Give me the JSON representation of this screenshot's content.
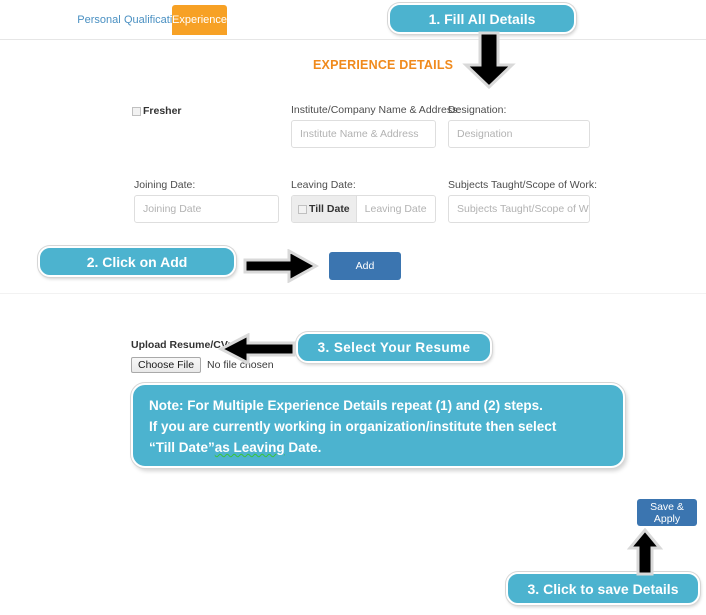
{
  "tabs": [
    {
      "id": "personal",
      "label": "Personal",
      "active": false
    },
    {
      "id": "qualification",
      "label": "Qualification",
      "active": false
    },
    {
      "id": "experience",
      "label": "Experience",
      "active": true
    }
  ],
  "section": {
    "title": "EXPERIENCE DETAILS"
  },
  "form": {
    "fresher": {
      "label": "Fresher",
      "checked": false
    },
    "institute": {
      "label": "Institute/Company Name & Address:",
      "placeholder": "Institute Name & Address",
      "value": ""
    },
    "designation": {
      "label": "Designation:",
      "placeholder": "Designation",
      "value": ""
    },
    "joining_date": {
      "label": "Joining Date:",
      "placeholder": "Joining Date",
      "value": ""
    },
    "leaving_date": {
      "label": "Leaving Date:",
      "placeholder": "Leaving Date",
      "value": "",
      "till_date_label": "Till Date",
      "till_date_checked": false
    },
    "subjects": {
      "label": "Subjects Taught/Scope of Work:",
      "placeholder": "Subjects Taught/Scope of Work",
      "value": ""
    },
    "add_button": "Add",
    "upload": {
      "label": "Upload Resume/CV:",
      "choose_button": "Choose File",
      "file_status": "No file chosen"
    },
    "save_button": "Save & Apply"
  },
  "callouts": {
    "step1": "1. Fill All Details",
    "step2": "2. Click on Add",
    "step3_resume": "3. Select Your Resume",
    "step3_save": "3. Click to save Details"
  },
  "note": {
    "line1": "Note: For Multiple Experience Details repeat (1) and (2) steps.",
    "line2": "If you are currently working in organization/institute then select",
    "line3_part1": "“Till Date”",
    "line3_underlined": "as  Leaving",
    "line3_part2": " Date."
  },
  "colors": {
    "accent_orange": "#f7a125",
    "title_orange": "#f08a1c",
    "callout_teal": "#4cb3cf",
    "button_blue": "#3b75b0",
    "tab_link": "#4a90c2"
  }
}
